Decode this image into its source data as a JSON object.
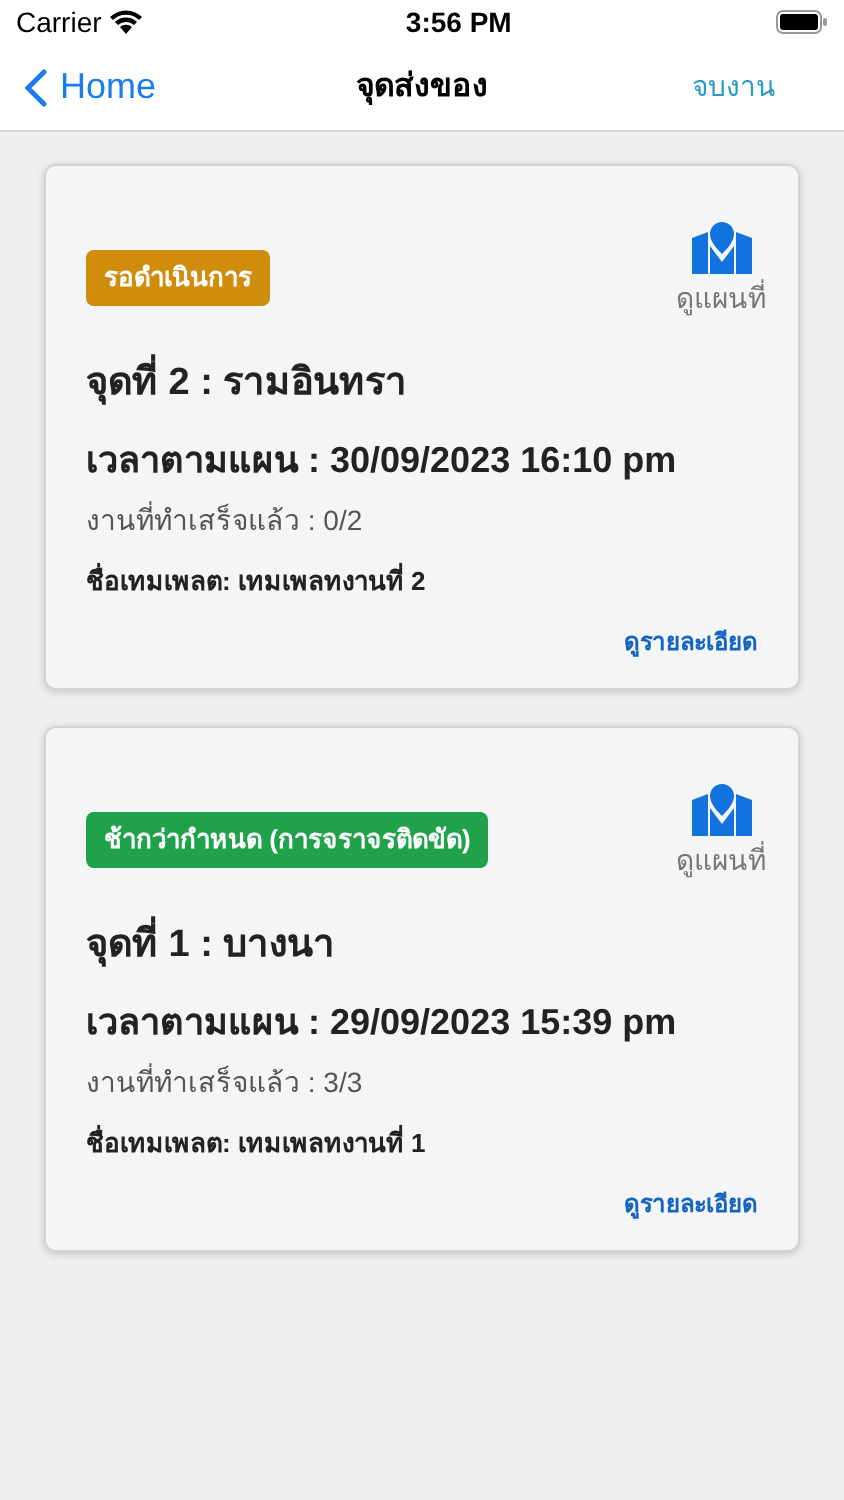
{
  "status_bar": {
    "carrier": "Carrier",
    "time": "3:56 PM"
  },
  "nav": {
    "back": "Home",
    "title": "จุดส่งของ",
    "action": "จบงาน"
  },
  "stops": [
    {
      "status": "รอดำเนินการ",
      "color": "#d08c0b",
      "map_label": "ดูแผนที่",
      "title": "จุดที่ 2 : รามอินทรา",
      "planned_time": "เวลาตามแผน : 30/09/2023 16:10 pm",
      "progress": "งานที่ทำเสร็จแล้ว : 0/2",
      "template": "ชื่อเทมเพลต: เทมเพลทงานที่ 2",
      "details": "ดูรายละเอียด"
    },
    {
      "status": "ช้ากว่ากำหนด (การจราจรติดขัด)",
      "color": "#1fa24a",
      "map_label": "ดูแผนที่",
      "title": "จุดที่ 1 : บางนา",
      "planned_time": "เวลาตามแผน : 29/09/2023 15:39 pm",
      "progress": "งานที่ทำเสร็จแล้ว : 3/3",
      "template": "ชื่อเทมเพลต: เทมเพลทงานที่ 1",
      "details": "ดูรายละเอียด"
    }
  ]
}
